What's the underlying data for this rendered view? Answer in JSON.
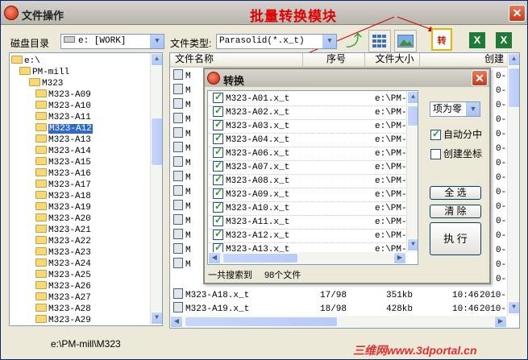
{
  "window": {
    "title": "文件操作",
    "annotation": "批量转换模块",
    "close": "✕"
  },
  "toolbar": {
    "disk_label": "磁盘目录",
    "disk_value": "e: [WORK]",
    "filetype_label": "文件类型:",
    "filetype_value": "Parasolid(*.x_t)",
    "icons": [
      "refresh-arrow-icon",
      "grid-view-icon",
      "image-view-icon",
      "convert-icon",
      "excel-icon",
      "excel-export-icon"
    ]
  },
  "tree": {
    "items": [
      {
        "label": "e:\\",
        "level": 0
      },
      {
        "label": "PM-mill",
        "level": 1
      },
      {
        "label": "M323",
        "level": 2
      },
      {
        "label": "M323-A09",
        "level": 3
      },
      {
        "label": "M323-A10",
        "level": 3
      },
      {
        "label": "M323-A11",
        "level": 3
      },
      {
        "label": "M323-A12",
        "level": 3,
        "selected": true
      },
      {
        "label": "M323-A13",
        "level": 3
      },
      {
        "label": "M323-A14",
        "level": 3
      },
      {
        "label": "M323-A15",
        "level": 3
      },
      {
        "label": "M323-A16",
        "level": 3
      },
      {
        "label": "M323-A17",
        "level": 3
      },
      {
        "label": "M323-A18",
        "level": 3
      },
      {
        "label": "M323-A19",
        "level": 3
      },
      {
        "label": "M323-A20",
        "level": 3
      },
      {
        "label": "M323-A21",
        "level": 3
      },
      {
        "label": "M323-A22",
        "level": 3
      },
      {
        "label": "M323-A23",
        "level": 3
      },
      {
        "label": "M323-A24",
        "level": 3
      },
      {
        "label": "M323-A25",
        "level": 3
      },
      {
        "label": "M323-A26",
        "level": 3
      },
      {
        "label": "M323-A27",
        "level": 3
      },
      {
        "label": "M323-A28",
        "level": 3
      },
      {
        "label": "M323-A29",
        "level": 3
      }
    ]
  },
  "filelist": {
    "columns": [
      "文件名称",
      "序号",
      "文件大小",
      "创建"
    ],
    "visible_rows_prefix": [
      "M",
      "M",
      "M",
      "M",
      "M",
      "M",
      "M",
      "M",
      "M",
      "M",
      "M",
      "M",
      "M",
      "M"
    ],
    "rows": [
      {
        "name": "M323-A18.x_t",
        "index": "17/98",
        "size": "351kb",
        "time": "10:46",
        "date": "2010-"
      },
      {
        "name": "M323-A19.x_t",
        "index": "18/98",
        "size": "428kb",
        "time": "10:46",
        "date": "2010-"
      }
    ],
    "right_edge": [
      "0-",
      "0-",
      "0-",
      "0-",
      "0-",
      "0-",
      "0-",
      "0-",
      "0-",
      "0-",
      "0-",
      "0-",
      "0-",
      "0-",
      "0-"
    ]
  },
  "status_path": "e:\\PM-mill\\M323",
  "watermark": "三维网www.3dportal.cn",
  "dialog": {
    "title": "转换",
    "close": "✕",
    "files": [
      {
        "name": "M323-A01.x_t",
        "path": "e:\\PM-m",
        "checked": true
      },
      {
        "name": "M323-A02.x_t",
        "path": "e:\\PM-m",
        "checked": true
      },
      {
        "name": "M323-A03.x_t",
        "path": "e:\\PM-m",
        "checked": true
      },
      {
        "name": "M323-A04.x_t",
        "path": "e:\\PM-m",
        "checked": true
      },
      {
        "name": "M323-A06.x_t",
        "path": "e:\\PM-m",
        "checked": true
      },
      {
        "name": "M323-A07.x_t",
        "path": "e:\\PM-m",
        "checked": true
      },
      {
        "name": "M323-A08.x_t",
        "path": "e:\\PM-m",
        "checked": true
      },
      {
        "name": "M323-A09.x_t",
        "path": "e:\\PM-m",
        "checked": true
      },
      {
        "name": "M323-A10.x_t",
        "path": "e:\\PM-m",
        "checked": true
      },
      {
        "name": "M323-A11.x_t",
        "path": "e:\\PM-m",
        "checked": true
      },
      {
        "name": "M323-A12.x_t",
        "path": "e:\\PM-m",
        "checked": true
      },
      {
        "name": "M323-A13.x_t",
        "path": "e:\\PM-m",
        "checked": true
      }
    ],
    "mode_value": "项为零",
    "auto_split_label": "自动分中",
    "auto_split_checked": true,
    "create_coord_label": "创建坐标",
    "create_coord_checked": false,
    "select_all": "全 选",
    "clear": "清 除",
    "run": "执 行",
    "search_label": "一共搜索到",
    "search_count": "98个文件"
  }
}
